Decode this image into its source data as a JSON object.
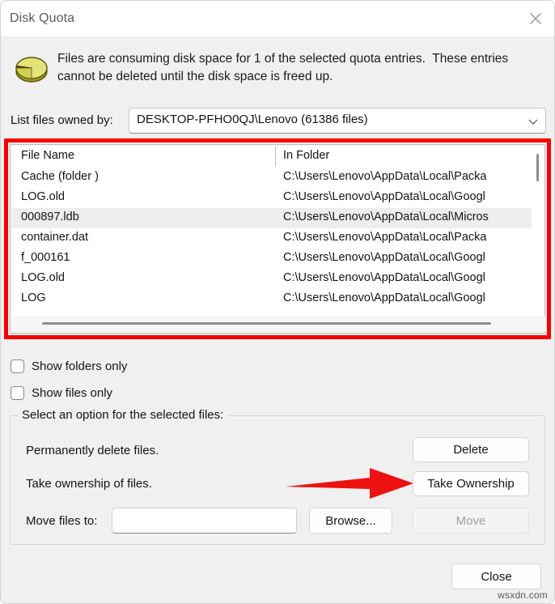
{
  "window": {
    "title": "Disk Quota",
    "close_icon": "close-icon"
  },
  "banner": {
    "icon": "disk-quota-pie-icon",
    "line1": "Files are consuming disk space for 1 of the selected quota entries.  These entries",
    "line2": "cannot be deleted until the disk space is freed up."
  },
  "owner_filter": {
    "label": "List files owned by:",
    "value": "DESKTOP-PFHO0QJ\\Lenovo (61386 files)",
    "caret_icon": "chevron-down-icon"
  },
  "file_list": {
    "columns": [
      "File Name",
      "In Folder"
    ],
    "rows": [
      {
        "name": "Cache  (folder )",
        "folder": "C:\\Users\\Lenovo\\AppData\\Local\\Packa",
        "selected": false
      },
      {
        "name": "LOG.old",
        "folder": "C:\\Users\\Lenovo\\AppData\\Local\\Googl",
        "selected": false
      },
      {
        "name": "000897.ldb",
        "folder": "C:\\Users\\Lenovo\\AppData\\Local\\Micros",
        "selected": true
      },
      {
        "name": "container.dat",
        "folder": "C:\\Users\\Lenovo\\AppData\\Local\\Packa",
        "selected": false
      },
      {
        "name": "f_000161",
        "folder": "C:\\Users\\Lenovo\\AppData\\Local\\Googl",
        "selected": false
      },
      {
        "name": "LOG.old",
        "folder": "C:\\Users\\Lenovo\\AppData\\Local\\Googl",
        "selected": false
      },
      {
        "name": "LOG",
        "folder": "C:\\Users\\Lenovo\\AppData\\Local\\Googl",
        "selected": false
      }
    ]
  },
  "checkboxes": [
    {
      "label": "Show folders only",
      "checked": false
    },
    {
      "label": "Show files only",
      "checked": false
    }
  ],
  "options_group": {
    "title": "Select an option for the selected files:",
    "delete_label": "Permanently delete files.",
    "delete_button": "Delete",
    "ownership_label": "Take ownership of files.",
    "ownership_button": "Take Ownership",
    "move_label": "Move files to:",
    "move_input_value": "",
    "move_input_placeholder": "",
    "browse_button": "Browse...",
    "move_button": "Move"
  },
  "footer": {
    "close_button": "Close"
  },
  "annotations": {
    "highlight_color": "#f60000",
    "arrow_color": "#ee1111",
    "arrow_target": "Take Ownership"
  },
  "watermark": {
    "text": "wsxdn.com"
  }
}
